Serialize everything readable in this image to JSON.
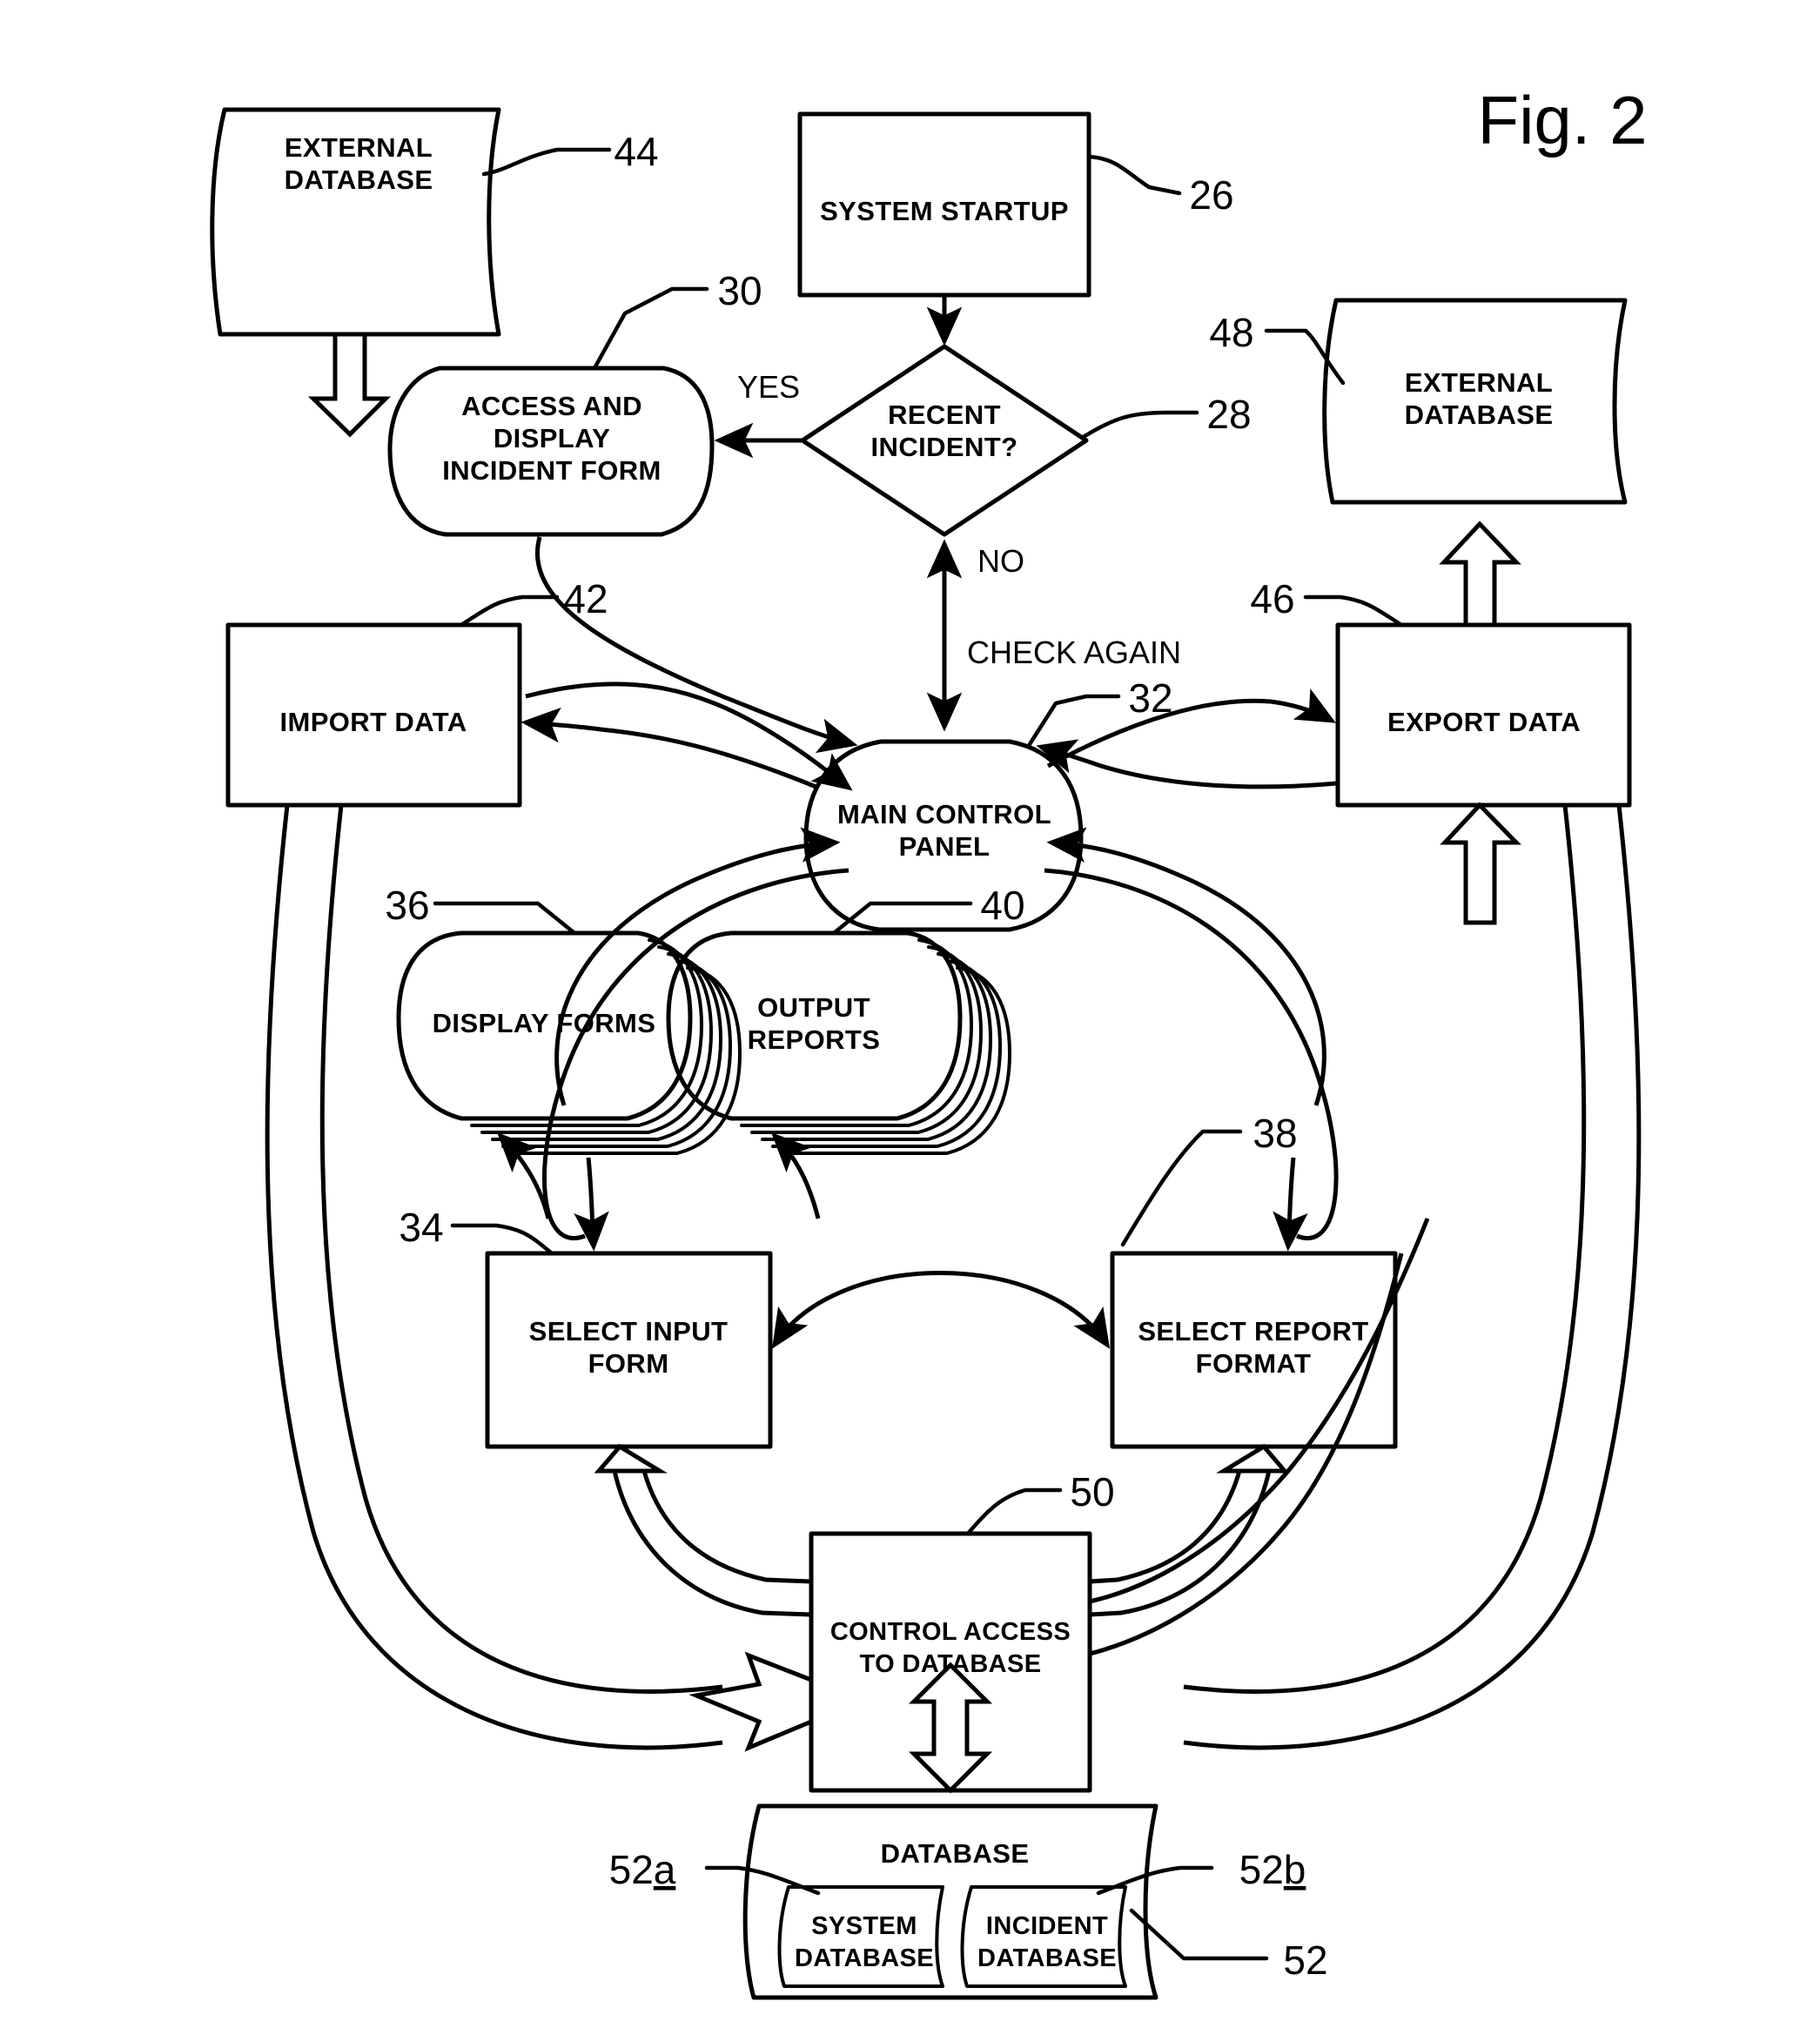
{
  "figure": {
    "title": "Fig. 2",
    "type": "patent-flow-diagram"
  },
  "nodes": {
    "system_startup": {
      "label": "SYSTEM STARTUP",
      "ref": "26",
      "shape": "rectangle"
    },
    "recent_incident": {
      "label_line1": "RECENT",
      "label_line2": "INCIDENT?",
      "ref": "28",
      "shape": "diamond"
    },
    "access_display": {
      "label_line1": "ACCESS AND",
      "label_line2": "DISPLAY",
      "label_line3": "INCIDENT FORM",
      "ref": "30",
      "shape": "blob"
    },
    "external_db_left": {
      "label_line1": "EXTERNAL",
      "label_line2": "DATABASE",
      "ref": "44",
      "shape": "wavy-document"
    },
    "external_db_right": {
      "label_line1": "EXTERNAL",
      "label_line2": "DATABASE",
      "ref": "48",
      "shape": "wavy-document"
    },
    "import_data": {
      "label": "IMPORT DATA",
      "ref": "42",
      "shape": "rectangle"
    },
    "export_data": {
      "label": "EXPORT DATA",
      "ref": "46",
      "shape": "rectangle"
    },
    "main_control_panel": {
      "label_line1": "MAIN CONTROL",
      "label_line2": "PANEL",
      "ref": "32",
      "shape": "blob"
    },
    "display_forms": {
      "label": "DISPLAY FORMS",
      "ref": "36",
      "shape": "stacked-blob"
    },
    "output_reports": {
      "label_line1": "OUTPUT",
      "label_line2": "REPORTS",
      "ref": "40",
      "shape": "stacked-blob"
    },
    "select_input_form": {
      "label_line1": "SELECT INPUT",
      "label_line2": "FORM",
      "ref": "34",
      "shape": "rectangle"
    },
    "select_report_format": {
      "label_line1": "SELECT REPORT",
      "label_line2": "FORMAT",
      "ref": "38",
      "shape": "rectangle"
    },
    "control_access": {
      "label_line1": "CONTROL ACCESS",
      "label_line2": "TO DATABASE",
      "ref": "50",
      "shape": "rectangle"
    },
    "database": {
      "label": "DATABASE",
      "ref": "52",
      "shape": "wavy-document"
    },
    "system_database": {
      "label_line1": "SYSTEM",
      "label_line2": "DATABASE",
      "ref": "52a",
      "ref_plain": "52",
      "ref_sub": "a",
      "shape": "wavy-document"
    },
    "incident_database": {
      "label_line1": "INCIDENT",
      "label_line2": "DATABASE",
      "ref": "52b",
      "ref_plain": "52",
      "ref_sub": "b",
      "shape": "wavy-document"
    }
  },
  "edge_labels": {
    "yes": "YES",
    "no": "NO",
    "check_again": "CHECK AGAIN"
  },
  "reference_numerals": {
    "n26": "26",
    "n28": "28",
    "n30": "30",
    "n32": "32",
    "n34": "34",
    "n36": "36",
    "n38": "38",
    "n40": "40",
    "n42": "42",
    "n44": "44",
    "n46": "46",
    "n48": "48",
    "n50": "50",
    "n52": "52",
    "n52a_num": "52",
    "n52a_suffix": "a",
    "n52b_num": "52",
    "n52b_suffix": "b"
  },
  "colors": {
    "stroke": "#000000",
    "background": "#ffffff"
  }
}
